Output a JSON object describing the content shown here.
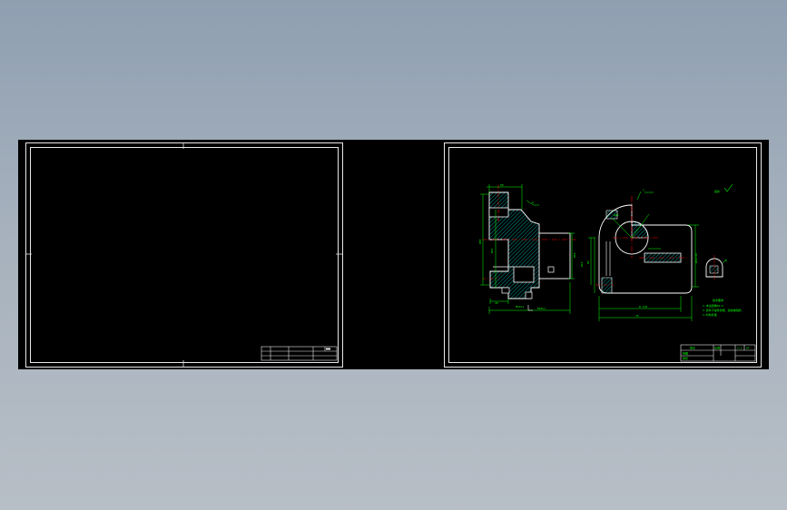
{
  "colors": {
    "background_top": "#8f9fb1",
    "background_bottom": "#b7bec6",
    "drawing_canvas": "#000000",
    "frame_lines": "#e8e8e8",
    "part_outline": "#ffffff",
    "dimension_lines": "#00ff00",
    "centerlines": "#ff0000",
    "hatching": "#00ffff",
    "notes": "#00ff00"
  },
  "sheets": [
    {
      "name": "blank-drawing-sheet",
      "title_block": "empty"
    },
    {
      "name": "part-drawing-sheet",
      "title_block": "filled"
    }
  ],
  "icons": {
    "roughness": "surface-roughness-icon"
  }
}
